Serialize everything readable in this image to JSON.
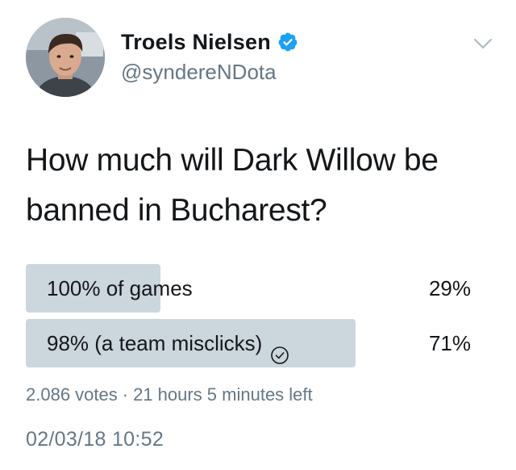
{
  "author": {
    "display_name": "Troels Nielsen",
    "handle": "@syndereNDota",
    "verified": true
  },
  "tweet": {
    "text_line1": "How much will Dark Willow be",
    "text_line2": "banned in Bucharest?"
  },
  "poll": {
    "options": [
      {
        "label": "100% of games",
        "percent": "29%",
        "fraction": 0.29,
        "selected": false
      },
      {
        "label": "98% (a team misclicks)",
        "percent": "71%",
        "fraction": 0.71,
        "selected": true
      }
    ],
    "votes": "2.086 votes",
    "separator": "·",
    "time_left": "21 hours 5 minutes left"
  },
  "timestamp": "02/03/18 10:52",
  "colors": {
    "poll_bar": "#ccd6dd",
    "verified_blue": "#1da1f2",
    "secondary_text": "#657786",
    "primary_text": "#14171a"
  },
  "icons": {
    "verified": "verified-badge-icon",
    "menu": "chevron-down-icon",
    "selected_option": "check-circle-icon"
  }
}
